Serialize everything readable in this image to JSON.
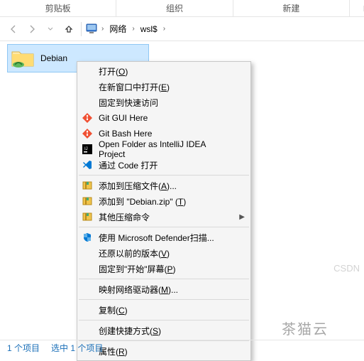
{
  "ribbon": {
    "tabs": [
      "剪贴板",
      "组织",
      "新建",
      ""
    ]
  },
  "nav": {
    "crumbs": [
      "网络",
      "wsl$"
    ]
  },
  "folder": {
    "name": "Debian"
  },
  "menu": [
    {
      "label": "打开(O)",
      "u": "O"
    },
    {
      "label": "在新窗口中打开(E)",
      "u": "E"
    },
    {
      "label": "固定到快速访问"
    },
    {
      "label": "Git GUI Here",
      "icon": "git"
    },
    {
      "label": "Git Bash Here",
      "icon": "git"
    },
    {
      "label": "Open Folder as IntelliJ IDEA Project",
      "icon": "ij"
    },
    {
      "label": "通过 Code 打开",
      "icon": "vscode"
    },
    {
      "sep": true
    },
    {
      "label": "添加到压缩文件(A)...",
      "u": "A",
      "icon": "zip"
    },
    {
      "label": "添加到 \"Debian.zip\" (T)",
      "u": "T",
      "icon": "zip"
    },
    {
      "label": "其他压缩命令",
      "icon": "zip",
      "sub": true
    },
    {
      "sep": true
    },
    {
      "label": "使用 Microsoft Defender扫描...",
      "icon": "defender"
    },
    {
      "label": "还原以前的版本(V)",
      "u": "V"
    },
    {
      "label": "固定到\"开始\"屏幕(P)",
      "u": "P"
    },
    {
      "sep": true
    },
    {
      "label": "映射网络驱动器(M)...",
      "u": "M"
    },
    {
      "sep": true
    },
    {
      "label": "复制(C)",
      "u": "C"
    },
    {
      "sep": true
    },
    {
      "label": "创建快捷方式(S)",
      "u": "S"
    },
    {
      "sep": true
    },
    {
      "label": "属性(R)",
      "u": "R"
    }
  ],
  "status": {
    "count": "1 个项目",
    "selected": "选中 1 个项目"
  },
  "watermark1": "茶猫云",
  "watermark2": "CSDN"
}
